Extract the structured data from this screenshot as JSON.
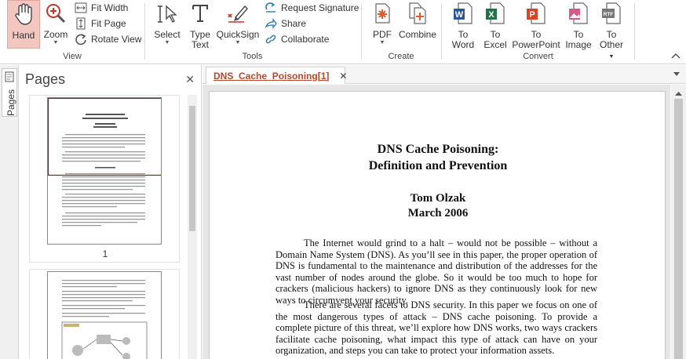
{
  "ribbon": {
    "view": {
      "hand": "Hand",
      "zoom": "Zoom",
      "fit_width": "Fit Width",
      "fit_page": "Fit Page",
      "rotate_view": "Rotate View",
      "group_label": "View"
    },
    "tools": {
      "select": "Select",
      "type_text_1": "Type",
      "type_text_2": "Text",
      "quicksign": "QuickSign",
      "request_signature": "Request Signature",
      "share": "Share",
      "collaborate": "Collaborate",
      "group_label": "Tools"
    },
    "create": {
      "pdf": "PDF",
      "combine": "Combine",
      "group_label": "Create"
    },
    "convert": {
      "to_word_1": "To",
      "to_word_2": "Word",
      "to_excel_1": "To",
      "to_excel_2": "Excel",
      "to_ppt_1": "To",
      "to_ppt_2": "PowerPoint",
      "to_image_1": "To",
      "to_image_2": "Image",
      "to_other_1": "To",
      "to_other_2": "Other",
      "group_label": "Convert"
    }
  },
  "pages_panel": {
    "tab_label": "Pages",
    "title": "Pages",
    "close": "✕",
    "thumb1_number": "1"
  },
  "document": {
    "tab_label": "DNS_Cache_Poisoning[1]",
    "tab_close": "✕",
    "title_line1": "DNS Cache Poisoning:",
    "title_line2": "Definition and Prevention",
    "author": "Tom Olzak",
    "date": "March 2006",
    "para1": "The Internet would grind to a halt – would not be possible – without a Domain Name System (DNS).  As you’ll see in this paper, the proper operation of DNS is fundamental to the maintenance and distribution of the addresses for the vast number of nodes around the globe.  So it would be too much to hope for crackers (malicious hackers) to ignore DNS as they continuously look for new ways to circumvent your security.",
    "para2": "There are several facets to DNS security.  In this paper we focus on one of the most dangerous types of attack – DNS cache poisoning.  To provide a complete picture of this threat, we’ll explore how DNS works, two ways crackers facilitate cache poisoning, what impact this type of attack can have on your organization, and steps you can take to protect your information assets."
  },
  "colors": {
    "accent": "#b7472a",
    "hand_active_bg": "#f4c6c0",
    "word": "#2b579a",
    "excel": "#217346",
    "powerpoint": "#d24726"
  }
}
